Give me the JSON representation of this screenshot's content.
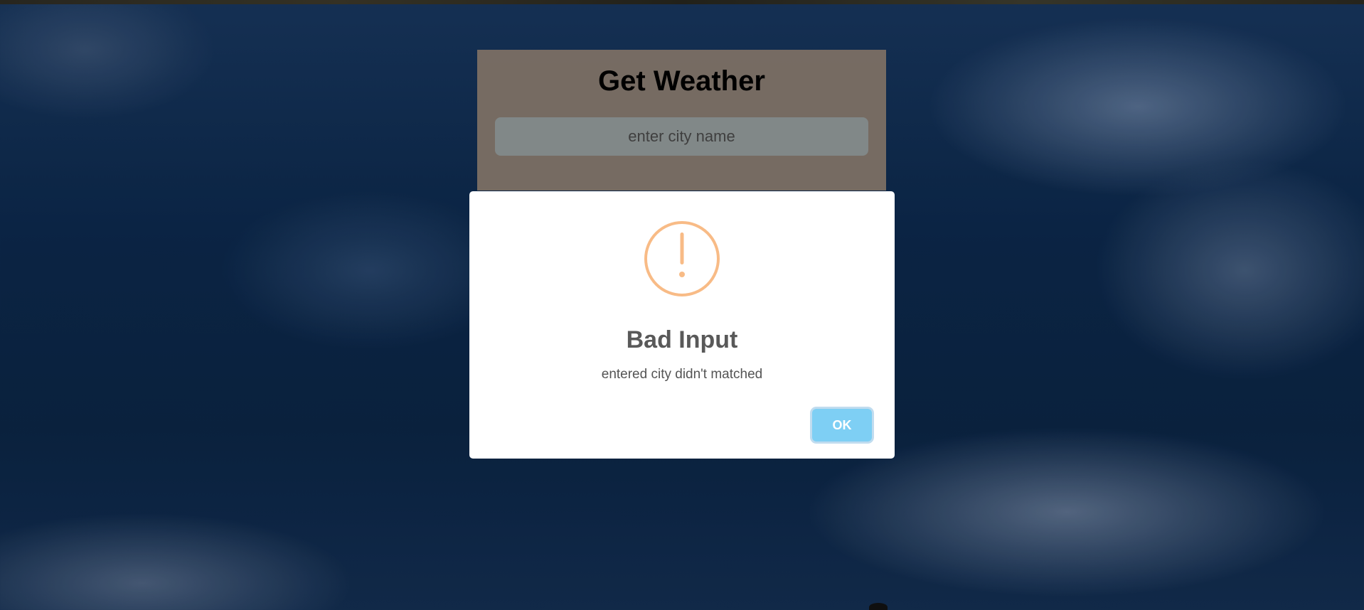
{
  "app": {
    "title": "Get Weather",
    "search": {
      "placeholder": "enter city name",
      "value": ""
    }
  },
  "alert": {
    "icon": "warning-icon",
    "icon_color": "#f8bb86",
    "title": "Bad Input",
    "message": "entered city didn't matched",
    "confirm_label": "OK",
    "confirm_color": "#7ecff4"
  }
}
